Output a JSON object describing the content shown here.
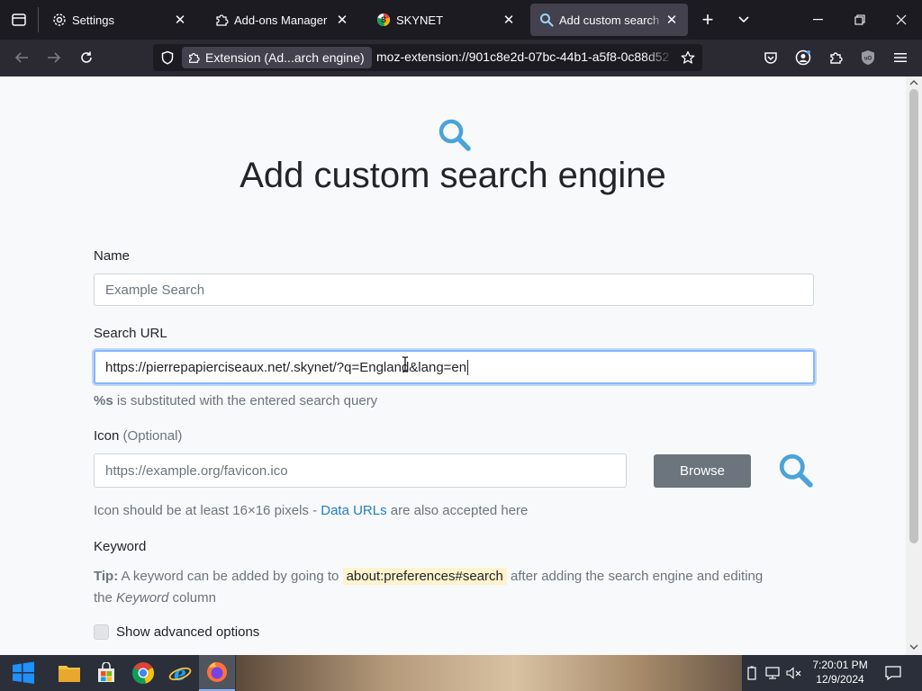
{
  "tabs": [
    {
      "label": "Settings",
      "icon": "gear-icon"
    },
    {
      "label": "Add-ons Manager",
      "icon": "puzzle-icon"
    },
    {
      "label": "SKYNET",
      "icon": "skynet-icon"
    },
    {
      "label": "Add custom search engine",
      "icon": "search-icon",
      "active": true
    }
  ],
  "urlbar": {
    "identity_label": "Extension (Ad...arch engine)",
    "url": "moz-extension://901c8e2d-07bc-44b1-a5f8-0c88d52"
  },
  "page": {
    "title": "Add custom search engine",
    "name_label": "Name",
    "name_placeholder": "Example Search",
    "url_label": "Search URL",
    "url_value": "https://pierrepapierciseaux.net/.skynet/?q=England&lang=en",
    "url_help_bold": "%s",
    "url_help_text": " is substituted with the entered search query",
    "icon_label": "Icon",
    "icon_optional": "(Optional)",
    "icon_placeholder": "https://example.org/favicon.ico",
    "browse_label": "Browse",
    "icon_help_prefix": "Icon should be at least 16×16 pixels - ",
    "icon_help_link": "Data URLs",
    "icon_help_suffix": " are also accepted here",
    "keyword_label": "Keyword",
    "tip_bold": "Tip:",
    "tip_text1": " A keyword can be added by going to ",
    "tip_code": "about:preferences#search",
    "tip_text2": " after adding the search engine and editing",
    "tip_text3": "the ",
    "tip_italic": "Keyword",
    "tip_text4": " column",
    "advanced_label": "Show advanced options"
  },
  "taskbar": {
    "time": "7:20:01 PM",
    "date": "12/9/2024"
  },
  "colors": {
    "accent_icon": "#4aa3d9",
    "content_bg": "#f8f9fa",
    "browse_btn": "#6c757d"
  }
}
